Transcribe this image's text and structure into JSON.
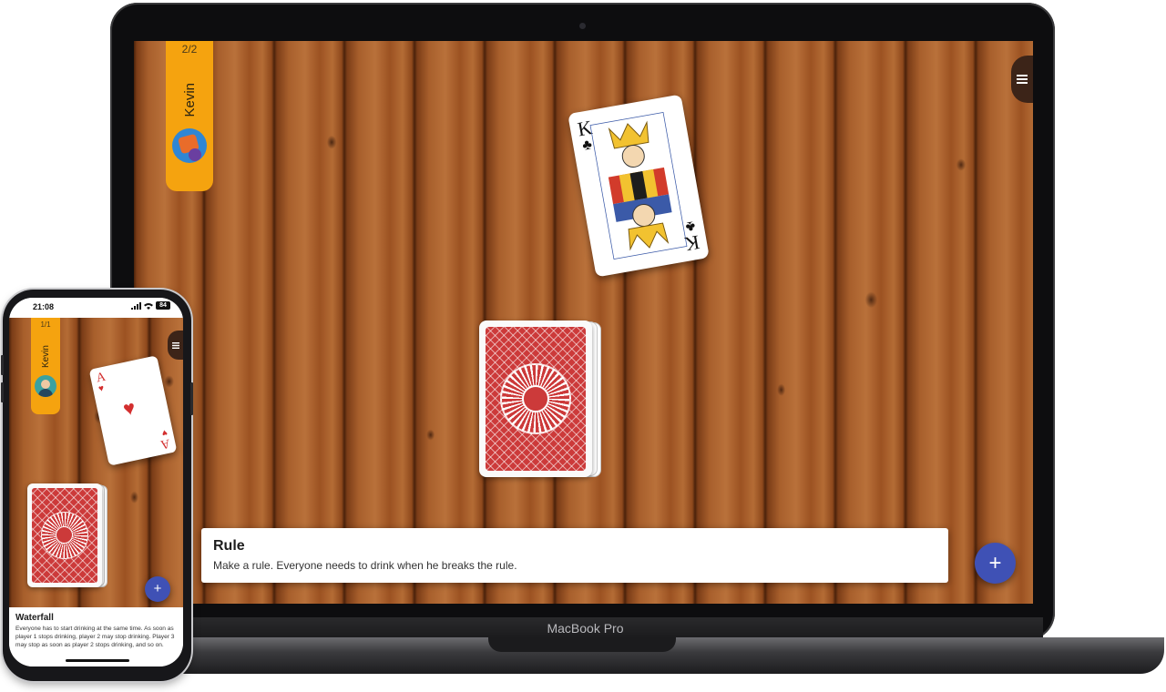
{
  "laptop": {
    "brand_label": "MacBook Pro",
    "game": {
      "player": {
        "count": "2/2",
        "name": "Kevin"
      },
      "face_card": {
        "rank": "K",
        "suit": "♣",
        "color": "#111111"
      },
      "rule": {
        "title": "Rule",
        "text": "Make a rule. Everyone needs to drink when he breaks the rule."
      },
      "fab_label": "+",
      "menu_icon": "hamburger-menu-icon"
    }
  },
  "phone": {
    "status": {
      "time": "21:08",
      "battery": "84"
    },
    "game": {
      "player": {
        "count": "1/1",
        "name": "Kevin"
      },
      "face_card": {
        "rank": "A",
        "suit": "♥",
        "color": "#d32f2f"
      },
      "rule": {
        "title": "Waterfall",
        "text": "Everyone has to start drinking at the same time. As soon as player 1 stops drinking, player 2 may stop drinking. Player 3 may stop as soon as player 2 stops drinking, and so on."
      },
      "fab_label": "+",
      "menu_icon": "hamburger-menu-icon"
    }
  },
  "colors": {
    "player_tab": "#f5a30f",
    "fab": "#3f51b5",
    "card_back": "#cc3a3a"
  }
}
